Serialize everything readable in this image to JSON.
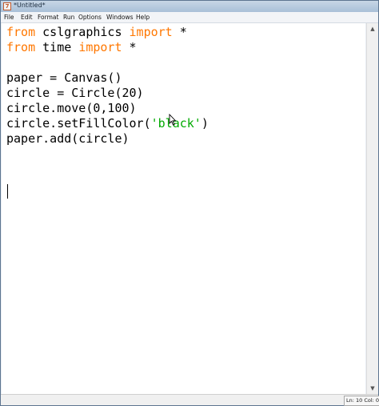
{
  "window": {
    "title": "*Untitled*",
    "app_icon": "idle-icon"
  },
  "menu": {
    "items": [
      "File",
      "Edit",
      "Format",
      "Run",
      "Options",
      "Windows",
      "Help"
    ]
  },
  "editor": {
    "lines": [
      [
        {
          "t": "from",
          "c": "kw"
        },
        {
          "t": " cslgraphics "
        },
        {
          "t": "import",
          "c": "kw"
        },
        {
          "t": " *"
        }
      ],
      [
        {
          "t": "from",
          "c": "kw"
        },
        {
          "t": " time "
        },
        {
          "t": "import",
          "c": "kw"
        },
        {
          "t": " *"
        }
      ],
      [],
      [
        {
          "t": "paper = Canvas()"
        }
      ],
      [
        {
          "t": "circle = Circle(20)"
        }
      ],
      [
        {
          "t": "circle.move(0,100)"
        }
      ],
      [
        {
          "t": "circle.setFillColor("
        },
        {
          "t": "'black'",
          "c": "str"
        },
        {
          "t": ")"
        }
      ],
      [
        {
          "t": "paper.add(circle)"
        }
      ],
      [],
      []
    ],
    "colors": {
      "keyword": "#ff7700",
      "string": "#00aa00",
      "text": "#000000"
    }
  },
  "status": {
    "position": "Ln: 10 Col: 0"
  }
}
